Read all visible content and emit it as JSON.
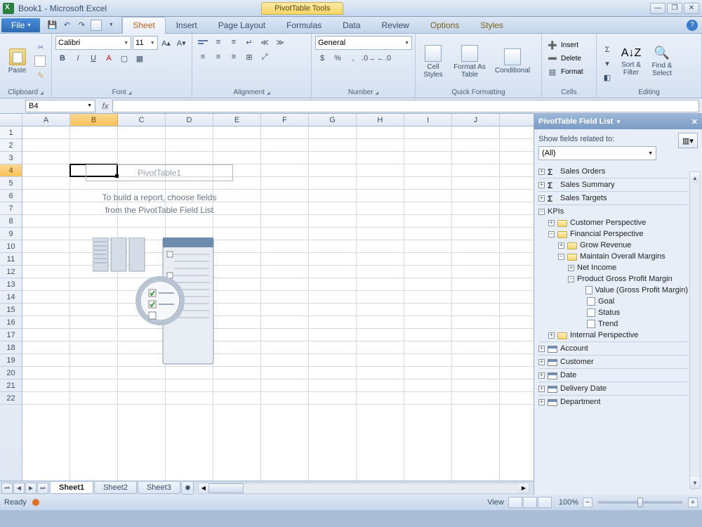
{
  "title": {
    "doc": "Book1",
    "app": "Microsoft Excel",
    "context_tools": "PivotTable Tools"
  },
  "menu": {
    "file": "File",
    "tabs": [
      "Sheet",
      "Insert",
      "Page Layout",
      "Formulas",
      "Data",
      "Review"
    ],
    "context_tabs": [
      "Options",
      "Styles"
    ]
  },
  "ribbon": {
    "groups": [
      "Clipboard",
      "Font",
      "Alignment",
      "Number",
      "Quick Formatting",
      "Cells",
      "Editing"
    ],
    "paste": "Paste",
    "font_name": "Calibri",
    "font_size": "11",
    "number_format": "General",
    "cell_styles": "Cell Styles",
    "format_as_table": "Format As Table",
    "conditional": "Conditional",
    "insert": "Insert",
    "delete": "Delete",
    "format": "Format",
    "sort_filter": "Sort & Filter",
    "find_select": "Find & Select"
  },
  "namebox": "B4",
  "columns": [
    "A",
    "B",
    "C",
    "D",
    "E",
    "F",
    "G",
    "H",
    "I",
    "J"
  ],
  "active_col_index": 1,
  "rows": 22,
  "active_row": 4,
  "pivot": {
    "title": "PivotTable1",
    "text1": "To build a report, choose fields",
    "text2": "from the PivotTable Field List"
  },
  "panel": {
    "title": "PivotTable Field List",
    "show_label": "Show fields related to:",
    "filter": "(All)",
    "tree": {
      "sales_orders": "Sales Orders",
      "sales_summary": "Sales Summary",
      "sales_targets": "Sales Targets",
      "kpis": "KPIs",
      "customer_perspective": "Customer Perspective",
      "financial_perspective": "Financial Perspective",
      "grow_revenue": "Grow Revenue",
      "maintain_margins": "Maintain Overall Margins",
      "net_income": "Net Income",
      "pgpm": "Product Gross Profit Margin",
      "value": "Value (Gross Profit Margin)",
      "goal": "Goal",
      "status": "Status",
      "trend": "Trend",
      "internal_perspective": "Internal Perspective",
      "account": "Account",
      "customer": "Customer",
      "date": "Date",
      "delivery_date": "Delivery Date",
      "department": "Department"
    }
  },
  "sheets": [
    "Sheet1",
    "Sheet2",
    "Sheet3"
  ],
  "status": {
    "ready": "Ready",
    "view": "View",
    "zoom": "100%"
  }
}
